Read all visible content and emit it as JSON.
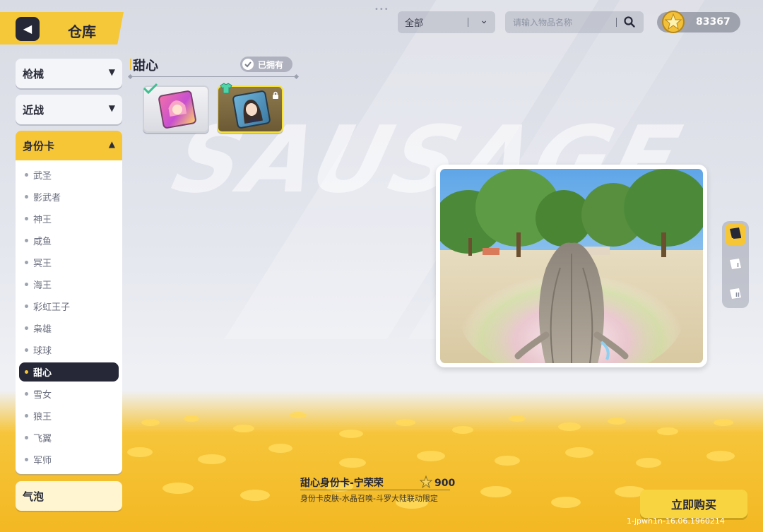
{
  "header": {
    "title": "仓库",
    "back_icon": "back-arrow-icon"
  },
  "filters": {
    "category_value": "全部",
    "search_placeholder": "请输入物品名称",
    "search_value": ""
  },
  "currency": {
    "amount": "83367",
    "icon": "star-coin-icon"
  },
  "sidebar": {
    "categories": [
      {
        "label": "枪械",
        "state": "collapsed"
      },
      {
        "label": "近战",
        "state": "collapsed"
      },
      {
        "label": "身份卡",
        "state": "expanded"
      }
    ],
    "subitems": [
      "武圣",
      "影武者",
      "神王",
      "咸鱼",
      "冥王",
      "海王",
      "彩虹王子",
      "枭雄",
      "球球",
      "甜心",
      "雪女",
      "狼王",
      "飞翼",
      "军师"
    ],
    "active_subitem": "甜心",
    "bottom_category": "气泡"
  },
  "section": {
    "title": "甜心",
    "owned_toggle_label": "已拥有",
    "owned_toggle_on": true
  },
  "items": [
    {
      "owned": true,
      "selected": false,
      "art_colors": [
        "#f06fa8",
        "#ffd166"
      ]
    },
    {
      "owned": false,
      "selected": true,
      "locked": true,
      "art_colors": [
        "#4a8db8",
        "#2f3f4f"
      ]
    }
  ],
  "selected_item": {
    "name": "甜心身份卡-宁荣荣",
    "price": "900",
    "description": "身份卡皮肤-水晶召唤-斗罗大陆联动限定",
    "buy_label": "立即购买"
  },
  "view_tabs": [
    "card-view-icon",
    "view-one-icon",
    "view-two-icon"
  ],
  "view_tab_labels": [
    "I",
    "II"
  ],
  "active_view_tab": 0,
  "footer": {
    "build_id": "1-jpwh1n-16.06.1960214"
  },
  "colors": {
    "accent_yellow": "#f6c637",
    "dark": "#262838",
    "cheese": "#f3b823"
  }
}
